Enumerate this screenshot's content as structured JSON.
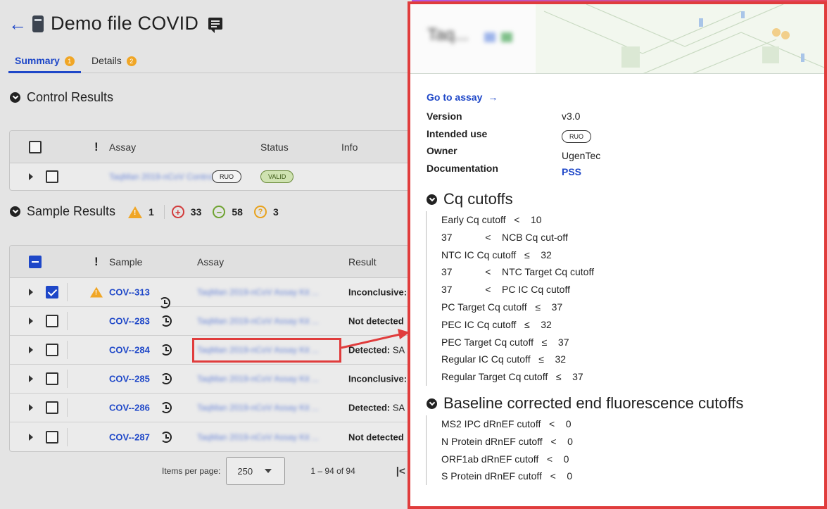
{
  "header": {
    "title": "Demo file COVID"
  },
  "tabs": [
    {
      "label": "Summary",
      "count": "1"
    },
    {
      "label": "Details",
      "count": "2"
    }
  ],
  "control": {
    "title": "Control Results",
    "headers": {
      "excl": "!",
      "assay": "Assay",
      "status": "Status",
      "info": "Info"
    },
    "row": {
      "assay": "TaqMan 2019-nCoV Control",
      "tag": "RUO",
      "status": "VALID"
    }
  },
  "samples": {
    "title": "Sample Results",
    "stats": {
      "warning": "1",
      "positive": "33",
      "negative": "58",
      "unknown": "3"
    },
    "headers": {
      "excl": "!",
      "sample": "Sample",
      "assay": "Assay",
      "result": "Result"
    },
    "rows": [
      {
        "id": "COV--313",
        "assay": "TaqMan 2019-nCoV Assay Kit ...",
        "result": "Inconclusive:",
        "detail": ""
      },
      {
        "id": "COV--283",
        "assay": "TaqMan 2019-nCoV Assay Kit ...",
        "result": "Not detected",
        "detail": ""
      },
      {
        "id": "COV--284",
        "assay": "TaqMan 2019-nCoV Assay Kit ...",
        "result": "Detected:",
        "detail": " SA"
      },
      {
        "id": "COV--285",
        "assay": "TaqMan 2019-nCoV Assay Kit ...",
        "result": "Inconclusive:",
        "detail": ""
      },
      {
        "id": "COV--286",
        "assay": "TaqMan 2019-nCoV Assay Kit ...",
        "result": "Detected:",
        "detail": " SA"
      },
      {
        "id": "COV--287",
        "assay": "TaqMan 2019-nCoV Assay Kit ...",
        "result": "Not detected",
        "detail": ""
      }
    ]
  },
  "pagination": {
    "label": "Items per page:",
    "value": "250",
    "range": "1 – 94 of 94"
  },
  "panel": {
    "title": "Taq...",
    "go_to_assay": "Go to assay",
    "fields": [
      {
        "key": "Version",
        "value": "v3.0"
      },
      {
        "key": "Intended use",
        "value": "RUO"
      },
      {
        "key": "Owner",
        "value": "UgenTec"
      },
      {
        "key": "Documentation",
        "value": "PSS"
      }
    ],
    "cq_title": "Cq cutoffs",
    "cq_cutoffs": [
      "Early Cq cutoff   <    10",
      "37            <    NCB Cq cut-off",
      "NTC IC Cq cutoff   ≤    32",
      "37            <    NTC Target Cq cutoff",
      "37            <    PC IC Cq cutoff",
      "PC Target Cq cutoff   ≤    37",
      "PEC IC Cq cutoff   ≤    32",
      "PEC Target Cq cutoff   ≤    37",
      "Regular IC Cq cutoff   ≤    32",
      "Regular Target Cq cutoff   ≤    37"
    ],
    "baseline_title": "Baseline corrected end fluorescence cutoffs",
    "baseline_cutoffs": [
      "MS2 IPC dRnEF cutoff   <    0",
      "N Protein dRnEF cutoff   <    0",
      "ORF1ab dRnEF cutoff   <    0",
      "S Protein dRnEF cutoff   <    0"
    ]
  },
  "colors": {
    "accent": "#1e47c8",
    "highlight": "#e03c3c",
    "warning": "#f0a626",
    "positive": "#d23c3c",
    "negative": "#6fa331",
    "unknown": "#e8a21c"
  }
}
